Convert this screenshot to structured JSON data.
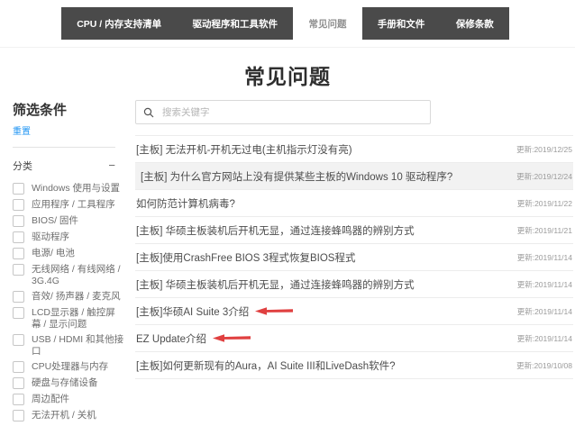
{
  "nav": {
    "tabs": [
      {
        "name": "tab-cpu-memory-support-list",
        "label": "CPU / 内存支持清单",
        "active": false
      },
      {
        "name": "tab-drivers-and-tools",
        "label": "驱动程序和工具软件",
        "active": false
      },
      {
        "name": "tab-faq",
        "label": "常见问题",
        "active": true
      },
      {
        "name": "tab-manuals-and-documents",
        "label": "手册和文件",
        "active": false
      },
      {
        "name": "tab-warranty-terms",
        "label": "保修条款",
        "active": false
      }
    ]
  },
  "page_title": "常见问题",
  "sidebar": {
    "title": "筛选条件",
    "reset_label": "重置",
    "category_label": "分类",
    "collapse_icon": "−",
    "categories": [
      "Windows 使用与设置",
      "应用程序 / 工具程序",
      "BIOS/ 固件",
      "驱动程序",
      "电源/ 电池",
      "无线网络 / 有线网络 / 3G.4G",
      "音效/ 扬声器 / 麦克风",
      "LCD显示器 / 触控屏幕 / 显示问题",
      "USB / HDMI 和其他接口",
      "CPU处理器与内存",
      "硬盘与存储设备",
      "周边配件",
      "无法开机 / 关机"
    ]
  },
  "search": {
    "placeholder": "搜索关键字",
    "icon": "magnifier"
  },
  "faq": {
    "items": [
      {
        "title": "[主板] 无法开机-开机无过电(主机指示灯没有亮)",
        "date": "更新:2019/12/25",
        "gray": false,
        "arrow": false
      },
      {
        "title": "[主板] 为什么官方网站上没有提供某些主板的Windows 10 驱动程序?",
        "date": "更新:2019/12/24",
        "gray": true,
        "arrow": false
      },
      {
        "title": "如何防范计算机病毒?",
        "date": "更新:2019/11/22",
        "gray": false,
        "arrow": false
      },
      {
        "title": "[主板] 华硕主板装机后开机无显，通过连接蜂鸣器的辨别方式",
        "date": "更新:2019/11/21",
        "gray": false,
        "arrow": false
      },
      {
        "title": "[主板]使用CrashFree BIOS 3程式恢复BIOS程式",
        "date": "更新:2019/11/14",
        "gray": false,
        "arrow": false
      },
      {
        "title": "[主板] 华硕主板装机后开机无显，通过连接蜂鸣器的辨别方式",
        "date": "更新:2019/11/14",
        "gray": false,
        "arrow": false
      },
      {
        "title": "[主板]华硕AI Suite 3介绍",
        "date": "更新:2019/11/14",
        "gray": false,
        "arrow": true
      },
      {
        "title": "EZ Update介绍",
        "date": "更新:2019/11/14",
        "gray": false,
        "arrow": true
      },
      {
        "title": "[主板]如何更新现有的Aura，AI Suite III和LiveDash软件?",
        "date": "更新:2019/10/08",
        "gray": false,
        "arrow": false
      }
    ]
  },
  "colors": {
    "nav_background": "#4a4a4a",
    "active_tab_text": "#8f8f8f",
    "reset_link_blue": "#2196f3",
    "row_highlight": "#f2f2f2",
    "annotation_arrow_red": "#e04040"
  }
}
